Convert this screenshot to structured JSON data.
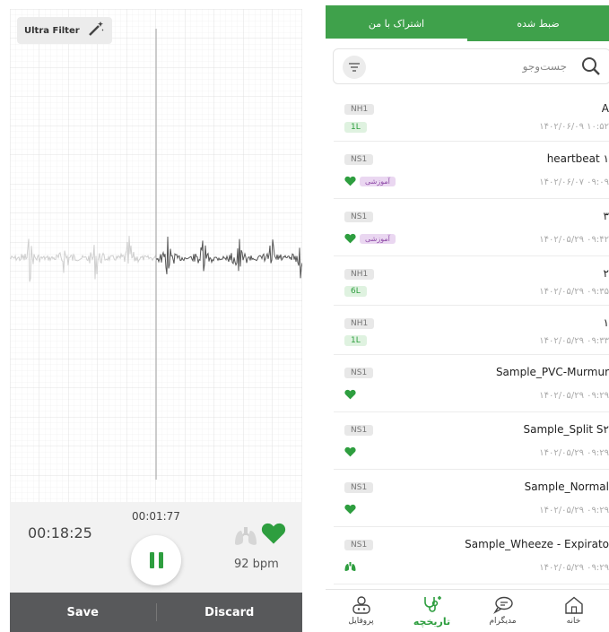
{
  "recorder": {
    "filter_label": "Ultra Filter",
    "filter_icon": "magic-wand-icon",
    "elapsed_time": "00:18:25",
    "clip_time": "00:01:77",
    "bpm": "92 bpm",
    "save_label": "Save",
    "discard_label": "Discard"
  },
  "history": {
    "tabs": [
      {
        "label": "اشتراک با من",
        "active": true
      },
      {
        "label": "ضبط شده",
        "active": false
      }
    ],
    "search_placeholder": "جست‌وجو",
    "recordings": [
      {
        "title": "A",
        "date": "۱۴۰۲/۰۶/۰۹ ۱۰:۵۲",
        "code": "NH1",
        "badge": "1L",
        "tag": "",
        "icon": ""
      },
      {
        "title": "heartbeat ۱",
        "date": "۱۴۰۲/۰۶/۰۷ ۰۹:۰۹",
        "code": "NS1",
        "badge": "",
        "tag": "آموزشی",
        "icon": "heart"
      },
      {
        "title": "۳",
        "date": "۱۴۰۲/۰۵/۲۹ ۰۹:۴۲",
        "code": "NS1",
        "badge": "",
        "tag": "آموزشی",
        "icon": "heart"
      },
      {
        "title": "۲",
        "date": "۱۴۰۲/۰۵/۲۹ ۰۹:۳۵",
        "code": "NH1",
        "badge": "6L",
        "tag": "",
        "icon": ""
      },
      {
        "title": "۱",
        "date": "۱۴۰۲/۰۵/۲۹ ۰۹:۳۳",
        "code": "NH1",
        "badge": "1L",
        "tag": "",
        "icon": ""
      },
      {
        "title": "Sample_PVC-Murmur",
        "date": "۱۴۰۲/۰۵/۲۹ ۰۹:۲۹",
        "code": "NS1",
        "badge": "",
        "tag": "",
        "icon": "heart"
      },
      {
        "title": "Sample_Split S۲",
        "date": "۱۴۰۲/۰۵/۲۹ ۰۹:۲۹",
        "code": "NS1",
        "badge": "",
        "tag": "",
        "icon": "heart"
      },
      {
        "title": "Sample_Normal",
        "date": "۱۴۰۲/۰۵/۲۹ ۰۹:۲۹",
        "code": "NS1",
        "badge": "",
        "tag": "",
        "icon": "heart"
      },
      {
        "title": "Sample_Wheeze - Expirato",
        "date": "۱۴۰۲/۰۵/۲۹ ۰۹:۲۹",
        "code": "NS1",
        "badge": "",
        "tag": "",
        "icon": "lungs"
      }
    ],
    "nav": [
      {
        "label": "خانه",
        "icon": "home-icon",
        "active": false
      },
      {
        "label": "مدیگرام",
        "icon": "chat-icon",
        "active": false
      },
      {
        "label": "تاریخچه",
        "icon": "stethoscope-icon",
        "active": true
      },
      {
        "label": "پروفایل",
        "icon": "profile-icon",
        "active": false
      }
    ]
  },
  "colors": {
    "brand_green": "#3fa14b",
    "heart_green": "#2e9e3f",
    "bottom_bar": "#58595b",
    "tag_purple": "#8e4aa7"
  }
}
